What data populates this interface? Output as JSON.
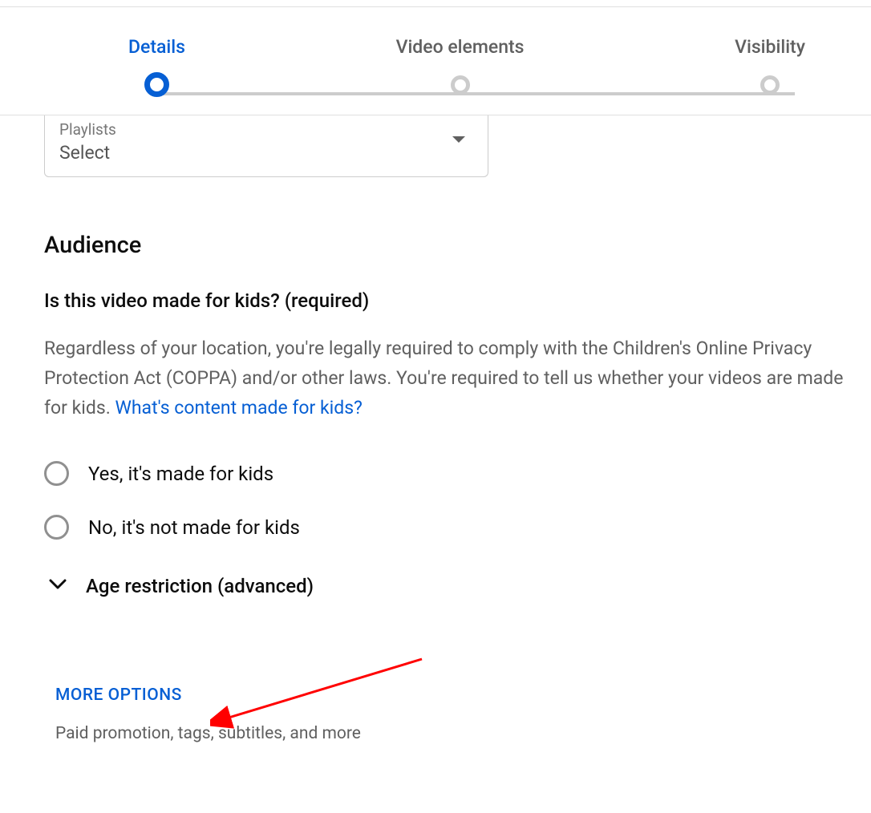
{
  "stepper": {
    "steps": [
      {
        "label": "Details",
        "active": true
      },
      {
        "label": "Video elements",
        "active": false
      },
      {
        "label": "Visibility",
        "active": false
      }
    ]
  },
  "playlists": {
    "label": "Playlists",
    "value": "Select"
  },
  "audience": {
    "title": "Audience",
    "subtitle": "Is this video made for kids? (required)",
    "description_prefix": "Regardless of your location, you're legally required to comply with the Children's Online Privacy Protection Act (COPPA) and/or other laws. You're required to tell us whether your videos are made for kids. ",
    "link_text": "What's content made for kids?",
    "radio_yes": "Yes, it's made for kids",
    "radio_no": "No, it's not made for kids"
  },
  "age_restriction": {
    "label": "Age restriction (advanced)"
  },
  "more_options": {
    "label": "MORE OPTIONS",
    "description": "Paid promotion, tags, subtitles, and more"
  }
}
